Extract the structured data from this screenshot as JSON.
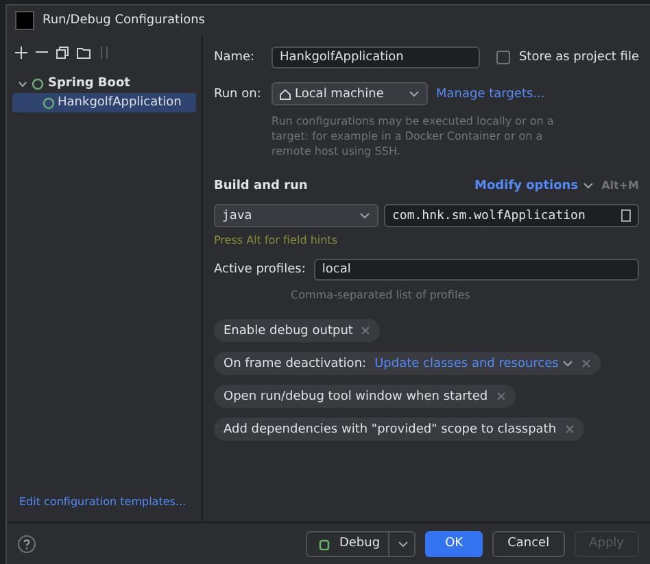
{
  "window": {
    "title": "Run/Debug Configurations"
  },
  "sidebar": {
    "tree": [
      {
        "label": "Spring Boot",
        "expanded": true,
        "selected": false,
        "children": [
          {
            "label": "HankgolfApplication",
            "selected": true
          }
        ]
      }
    ],
    "templates_link": "Edit configuration templates..."
  },
  "form": {
    "name_label": "Name:",
    "name_value": "HankgolfApplication",
    "store_label": "Store as project file",
    "store_checked": false,
    "run_on_label": "Run on:",
    "run_on_value": "Local machine",
    "manage_targets": "Manage targets...",
    "run_on_hint": "Run configurations may be executed locally or on a target: for example in a Docker Container or on a remote host using SSH.",
    "section_title": "Build and run",
    "modify_options": "Modify options",
    "modify_shortcut": "Alt+M",
    "jre_value": "java",
    "main_class": "com.hnk.sm.wolfApplication",
    "field_hint": "Press Alt for field hints",
    "profiles_label": "Active profiles:",
    "profiles_value": "local",
    "profiles_hint": "Comma-separated list of profiles"
  },
  "options": [
    {
      "kind": "plain",
      "label": "Enable debug output"
    },
    {
      "kind": "choice",
      "label": "On frame deactivation:",
      "value": "Update classes and resources"
    },
    {
      "kind": "plain",
      "label": "Open run/debug tool window when started"
    },
    {
      "kind": "plain",
      "label": "Add dependencies with \"provided\" scope to classpath"
    }
  ],
  "footer": {
    "buttons": [
      {
        "label": "Debug",
        "kind": "split"
      },
      {
        "label": "OK",
        "kind": "primary"
      },
      {
        "label": "Cancel",
        "kind": "normal"
      },
      {
        "label": "Apply",
        "kind": "disabled"
      }
    ]
  }
}
